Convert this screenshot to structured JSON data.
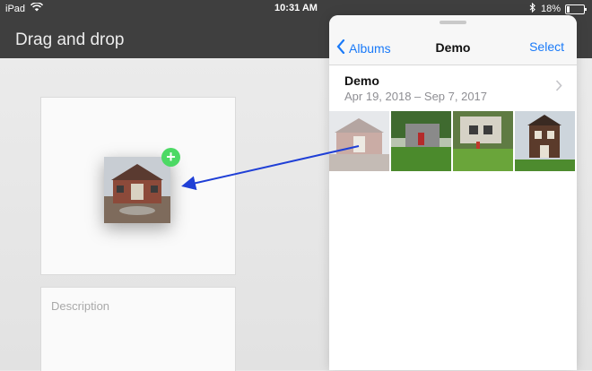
{
  "status": {
    "device": "iPad",
    "time": "10:31 AM",
    "battery": "18%",
    "battery_level": 0.18
  },
  "app": {
    "title": "Drag and drop"
  },
  "form": {
    "description_placeholder": "Description"
  },
  "panel": {
    "back_label": "Albums",
    "title": "Demo",
    "select_label": "Select",
    "album": {
      "name": "Demo",
      "dates": "Apr 19, 2018 – Sep 7, 2017"
    },
    "thumbnails": [
      "brick house",
      "gray house with red door",
      "house with lawn",
      "tall brick house"
    ]
  },
  "colors": {
    "accent": "#1a7af8",
    "add_badge": "#4cd964",
    "arrow": "#1f3fd6"
  },
  "icons": {
    "wifi": "wifi-icon",
    "bluetooth": "bluetooth-icon",
    "battery": "battery-icon",
    "add": "plus-icon",
    "back": "chevron-left-icon",
    "disclosure": "chevron-right-icon"
  }
}
